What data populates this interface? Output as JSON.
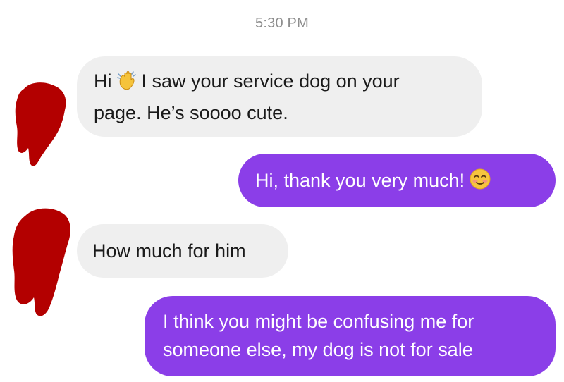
{
  "thread": {
    "timestamp": "5:30 PM",
    "messages": [
      {
        "direction": "incoming",
        "before_emoji": "Hi",
        "emoji": "waving-hand-icon",
        "after_emoji": "I saw your service dog on your",
        "line2": "page. He’s soooo cute."
      },
      {
        "direction": "outgoing",
        "text": "Hi, thank you very much!",
        "emoji": "smiling-blushing-face-icon"
      },
      {
        "direction": "incoming",
        "text": "How much for him"
      },
      {
        "direction": "outgoing",
        "line1": "I think you might be confusing me for",
        "line2": "someone else, my dog is not for sale"
      }
    ]
  },
  "colors": {
    "incoming_bubble": "#efefef",
    "outgoing_bubble": "#8b3ee8",
    "redaction": "#b30000",
    "timestamp_text": "#8e8e8e"
  }
}
